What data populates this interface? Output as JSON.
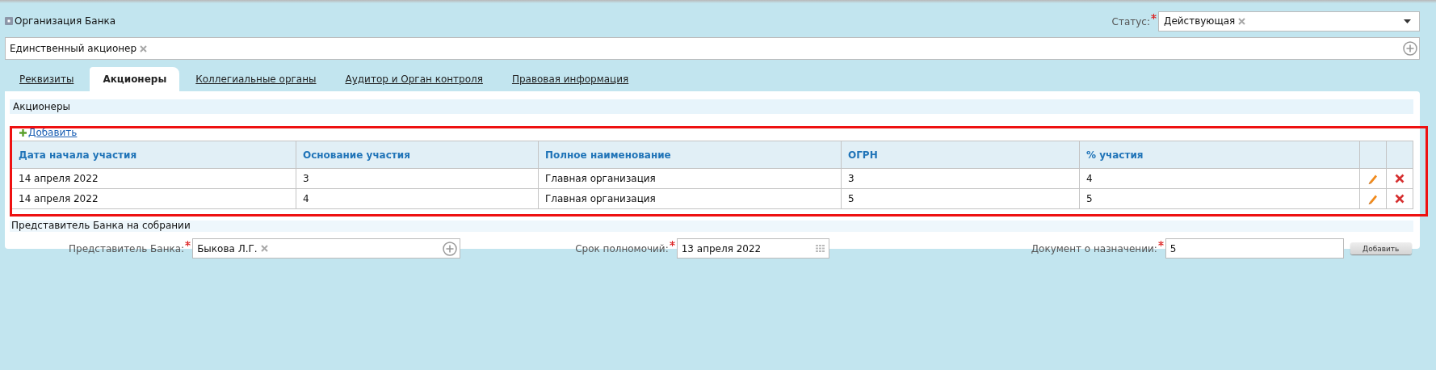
{
  "header": {
    "title": "Организация Банка",
    "status": {
      "label": "Статус:",
      "required": true,
      "value": "Действующая"
    }
  },
  "chip_field": {
    "chips": [
      "Единственный акционер"
    ]
  },
  "tabs": [
    {
      "label": "Реквизиты",
      "selected": false
    },
    {
      "label": "Акционеры",
      "selected": true
    },
    {
      "label": "Коллегиальные органы",
      "selected": false
    },
    {
      "label": "Аудитор и Орган контроля",
      "selected": false
    },
    {
      "label": "Правовая информация",
      "selected": false
    }
  ],
  "shareholders": {
    "title": "Акционеры",
    "add_link": "Добавить",
    "columns": [
      "Дата начала участия",
      "Основание участия",
      "Полное наименование",
      "ОГРН",
      "% участия"
    ],
    "rows": [
      {
        "cells": [
          "14 апреля 2022",
          "3",
          "Главная организация",
          "3",
          "4"
        ]
      },
      {
        "cells": [
          "14 апреля 2022",
          "4",
          "Главная организация",
          "5",
          "5"
        ]
      }
    ]
  },
  "representative": {
    "title": "Представитель Банка на собрании",
    "fields": [
      {
        "kind": "chip",
        "label": "Представитель Банка:",
        "required": true,
        "value": "Быкова Л.Г."
      },
      {
        "kind": "date",
        "label": "Срок полномочий:",
        "required": true,
        "value": "13 апреля 2022"
      },
      {
        "kind": "text",
        "label": "Документ о назначении:",
        "required": true,
        "value": "5"
      }
    ],
    "button": "Добавить"
  }
}
